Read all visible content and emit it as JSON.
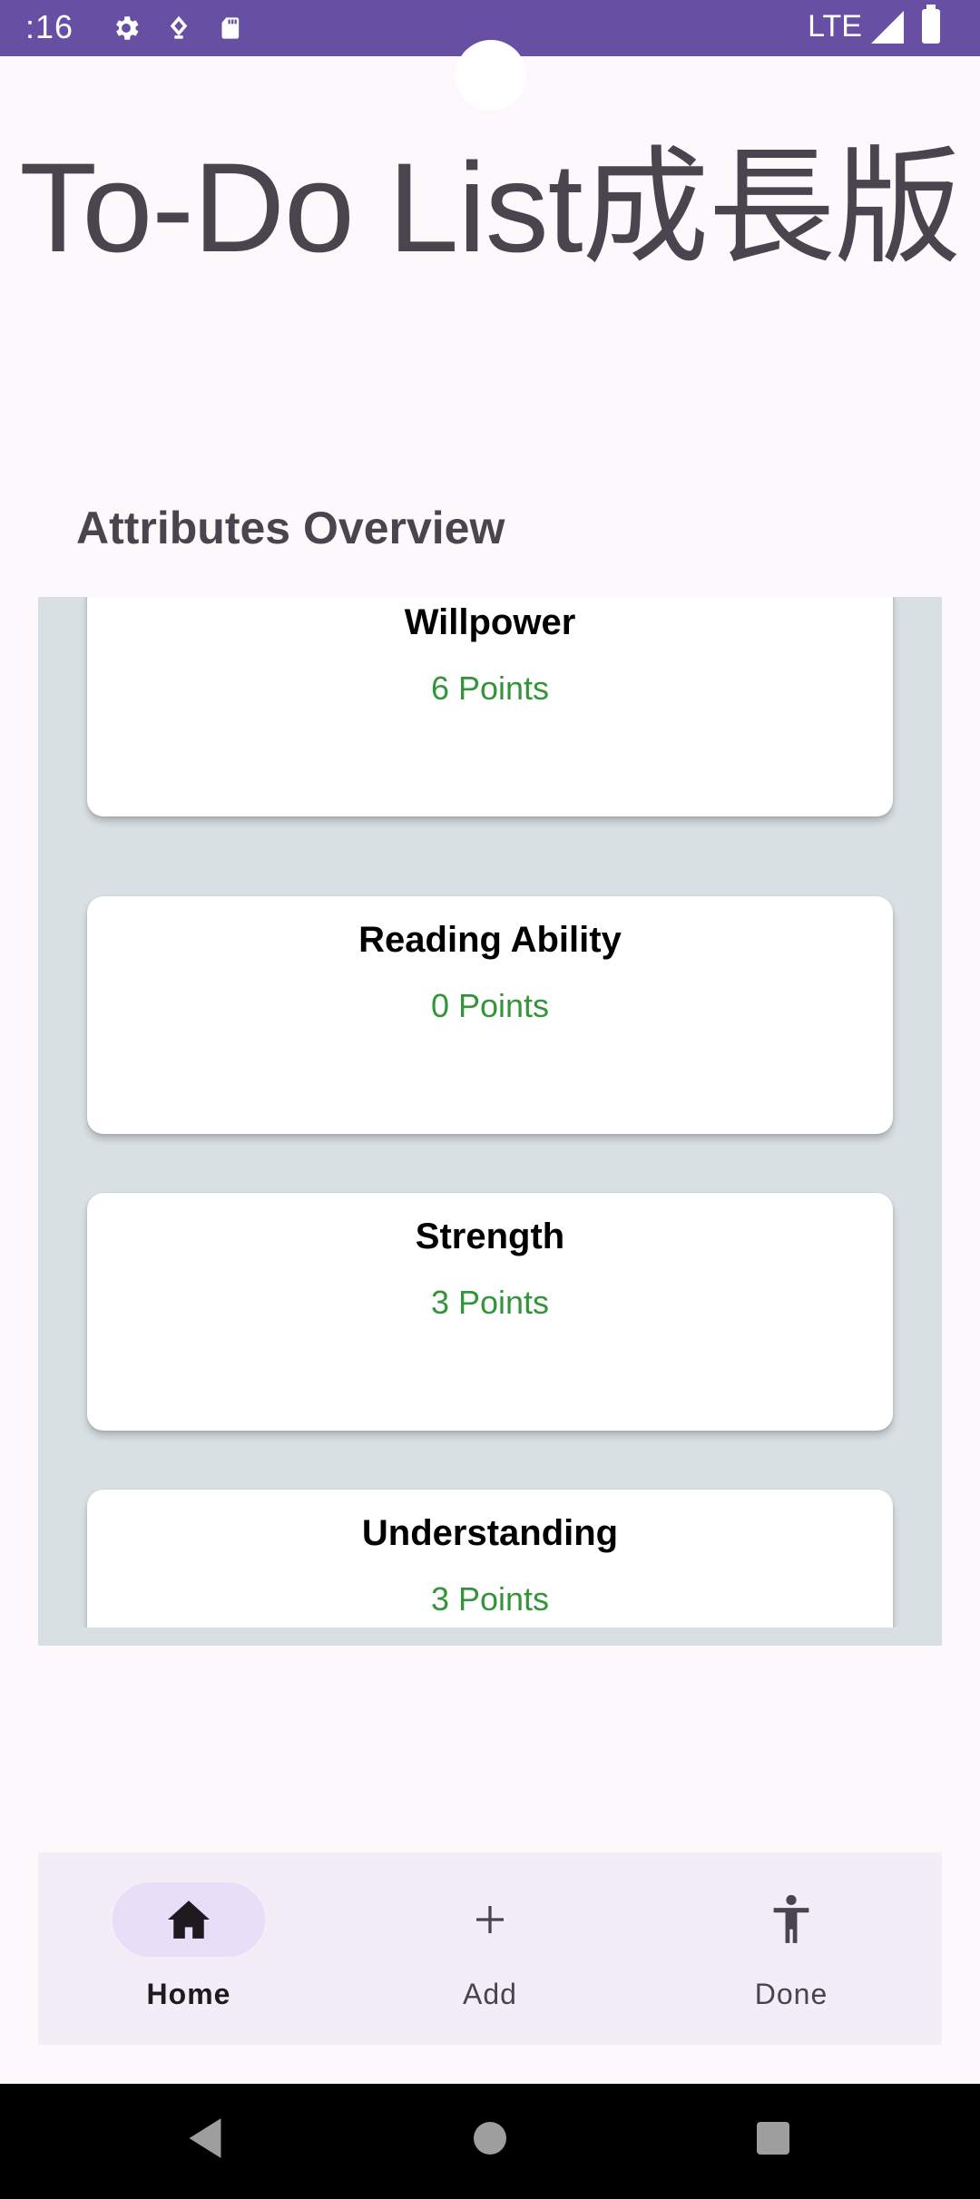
{
  "status_bar": {
    "time": ":16",
    "network": "LTE",
    "icons": [
      "settings-gear-icon",
      "location-icon",
      "sd-card-icon"
    ]
  },
  "app": {
    "title": "To-Do List成長版"
  },
  "overview": {
    "title": "Attributes Overview",
    "attributes": [
      {
        "name": "Willpower",
        "points": "6 Points"
      },
      {
        "name": "Reading Ability",
        "points": "0 Points"
      },
      {
        "name": "Strength",
        "points": "3 Points"
      },
      {
        "name": "Understanding",
        "points": "3 Points"
      }
    ]
  },
  "bottom_nav": {
    "items": [
      {
        "label": "Home",
        "icon": "home-icon",
        "active": true
      },
      {
        "label": "Add",
        "icon": "plus-icon",
        "active": false
      },
      {
        "label": "Done",
        "icon": "accessibility-person-icon",
        "active": false
      }
    ]
  },
  "system_nav": [
    "back-icon",
    "home-circle-icon",
    "recents-square-icon"
  ],
  "colors": {
    "status_bar": "#6750A4",
    "points_green": "#34943A",
    "list_bg": "#D8E0E3",
    "nav_bg": "#F3EDF7",
    "active_pill": "#E8DEF8"
  }
}
